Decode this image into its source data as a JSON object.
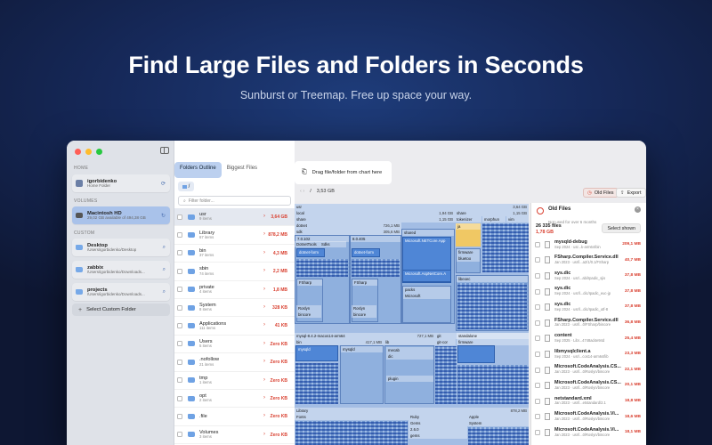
{
  "hero": {
    "title": "Find Large Files and Folders in Seconds",
    "subtitle": "Sunburst or Treemap. Free up space your way."
  },
  "sidebar": {
    "home_header": "HOME",
    "home_item": {
      "title": "igorbidenko",
      "sub": "Home Folder"
    },
    "volumes_header": "VOLUMES",
    "volume_item": {
      "title": "Macintosh HD",
      "sub": "29,02 GB available of 494,38 GB"
    },
    "custom_header": "CUSTOM",
    "custom_items": [
      {
        "title": "Desktop",
        "sub": "/Users/igorbidenko/Desktop"
      },
      {
        "title": "zabbix",
        "sub": "/Users/igorbidenko/Downloads..."
      },
      {
        "title": "projects",
        "sub": "/Users/igorbidenko/Downloads..."
      }
    ],
    "select_custom": "Select Custom Folder"
  },
  "list_panel": {
    "tabs": [
      "Folders Outline",
      "Biggest Files"
    ],
    "breadcrumb": "/",
    "filter_placeholder": "Filter folder...",
    "rows": [
      {
        "name": "usr",
        "items": "9 items",
        "size": "3,64 GB"
      },
      {
        "name": "Library",
        "items": "67 items",
        "size": "878,2 MB"
      },
      {
        "name": "bin",
        "items": "37 items",
        "size": "4,3 MB"
      },
      {
        "name": "sbin",
        "items": "74 items",
        "size": "2,2 MB"
      },
      {
        "name": "private",
        "items": "4 items",
        "size": "1,8 MB"
      },
      {
        "name": "System",
        "items": "8 items",
        "size": "328 KB"
      },
      {
        "name": "Applications",
        "items": "111 items",
        "size": "41 KB"
      },
      {
        "name": "Users",
        "items": "5 items",
        "size": "Zero KB"
      },
      {
        "name": ".nofollow",
        "items": "21 items",
        "size": "Zero KB"
      },
      {
        "name": "tmp",
        "items": "1 items",
        "size": "Zero KB"
      },
      {
        "name": "opt",
        "items": "2 items",
        "size": "Zero KB"
      },
      {
        "name": ".file",
        "items": "",
        "size": "Zero KB"
      },
      {
        "name": "Volumes",
        "items": "3 items",
        "size": "Zero KB"
      },
      {
        "name": "cores",
        "items": "1 items",
        "size": "Zero KB"
      }
    ]
  },
  "main": {
    "drop_zone": "Drag file/folder from chart here",
    "path_nav": "‹  ›",
    "path_slash": "/",
    "path_size": "3,53 GB",
    "old_files_btn": "Old Files",
    "export_btn": "Export",
    "treemap": {
      "usr": "usr",
      "usr_size": "3,64 GB",
      "local": "local",
      "local_size": "1,94 GB",
      "share": "share",
      "share_size": "1,15 GB",
      "dotnet": "dotnet",
      "dotnet_size": "726,1 MB",
      "sdk": "sdk",
      "sdk_size": "305,6 MB",
      "v7": "7.0.102",
      "v8": "8.0.405",
      "shared": "shared",
      "dotnet_form": "dotnet-form",
      "aspnet": "Microsoft.NETCore.App",
      "aspnet2": "Microsoft.AspNetCore.A",
      "fsharp": "FSharp",
      "roslyn": "Roslyn",
      "bincore": "bincore",
      "packs": "packs",
      "microsoft": "Microsoft",
      "dotnettools": "DotnetTools",
      "sdks": "Sdks",
      "share2": "share",
      "share2_size": "1,15 GB",
      "tokenizer": "tokenizer",
      "morphun": "morphun",
      "vim": "vim",
      "firmware": "firmware",
      "libexec": "libexec",
      "ja": "ja",
      "bluetoo": "bluetoo",
      "mysql": "mysql-8.4.2-macos14-arm64",
      "mysql_size": "727,1 MB",
      "bin": "bin",
      "bin_size": "417,1 MB",
      "mysqld": "mysqld",
      "lib": "lib",
      "mecab": "mecab",
      "dic": "dic",
      "plugin": "plugin",
      "libexec2": "libexec",
      "git": "git",
      "gitcor": "git-cor",
      "standalone": "standalone",
      "firmware2": "firmware",
      "library": "Library",
      "library_size": "878,2 MB",
      "fonts": "Fonts",
      "ruby": "Ruby",
      "apple": "Apple",
      "gems": "Gems",
      "system": "System",
      "gems_ver": "2.6.0",
      "gems_ver2": "gems",
      "v2": "2.6.0"
    },
    "old_files": {
      "title": "Old Files",
      "subtitle": "Not used for over 6 months",
      "count": "26 335 files",
      "total": "1,78 GB",
      "select_btn": "Select shown",
      "files": [
        {
          "name": "mysqld-debug",
          "meta": "Sep 2024 · usr...k-arm64/bin",
          "size": "209,1 MB"
        },
        {
          "name": "FSharp.Compiler.Service.dll",
          "meta": "Jan 2023 · usr/l...a2/1/0.1/FSharp",
          "size": "40,7 MB"
        },
        {
          "name": "sys.dic",
          "meta": "Sep 2024 · usr/...abi/Ipadic_sjis",
          "size": "37,8 MB"
        },
        {
          "name": "sys.dic",
          "meta": "Sep 2024 · usr/l...dic/Ipadic_euc-jp",
          "size": "37,8 MB"
        },
        {
          "name": "sys.dic",
          "meta": "Sep 2024 · usr/l...dic/Ipadic_utf-8",
          "size": "37,8 MB"
        },
        {
          "name": "FSharp.Compiler.Service.dll",
          "meta": "Jan 2023 · usr/l...0/FSharp/bincore",
          "size": "36,8 MB"
        },
        {
          "name": "content",
          "meta": "Sep 2025 · Libr...4748ad4e94d",
          "size": "25,4 MB"
        },
        {
          "name": "libmysqlclient.a",
          "meta": "Sep 2024 · usr/...cos14-arm64/lib",
          "size": "23,3 MB"
        },
        {
          "name": "Microsoft.CodeAnalysis.CS...",
          "meta": "Jan 2023 · usr/l...0/Roslyn/bincore",
          "size": "22,1 MB"
        },
        {
          "name": "Microsoft.CodeAnalysis.CS...",
          "meta": "Jan 2023 · usr/l...0/Roslyn/bincore",
          "size": "20,1 MB"
        },
        {
          "name": "netstandard.xml",
          "meta": "Jan 2023 · usr/l...etstandard/2.1",
          "size": "18,8 MB"
        },
        {
          "name": "Microsoft.CodeAnalysis.Vi...",
          "meta": "Jan 2023 · usr/l...0/Roslyn/bincore",
          "size": "18,6 MB"
        },
        {
          "name": "Microsoft.CodeAnalysis.Vi...",
          "meta": "Jan 2023 · usr/l...0/Roslyn/bincore",
          "size": "18,1 MB"
        }
      ]
    }
  }
}
